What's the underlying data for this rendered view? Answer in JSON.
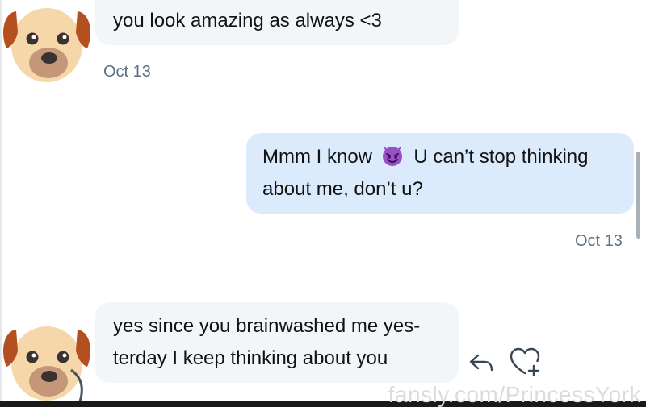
{
  "conversation": {
    "messages": [
      {
        "direction": "incoming",
        "lines": [
          "you look amazing as always <3"
        ],
        "timestamp": "Oct 13",
        "avatar_icon": "dog-face-icon"
      },
      {
        "direction": "outgoing",
        "lines": [
          "Mmm I know",
          "U can’t stop thinking",
          "about me, don’t u?"
        ],
        "emoji_icon": "smiling-devil-emoji-icon",
        "timestamp": "Oct 13"
      },
      {
        "direction": "incoming",
        "lines": [
          "yes since you brainwashed me yes-",
          "terday I keep thinking about you"
        ],
        "avatar_icon": "dog-face-icon"
      }
    ]
  },
  "actions": {
    "reply_icon": "reply-arrow-icon",
    "like_icon": "heart-plus-icon"
  },
  "watermark": {
    "text": "fansly.com/PrincessYork"
  },
  "colors": {
    "incoming_bubble": "#f3f6f9",
    "outgoing_bubble": "#dcebfb",
    "timestamp": "#5f6f84",
    "text": "#121212"
  }
}
